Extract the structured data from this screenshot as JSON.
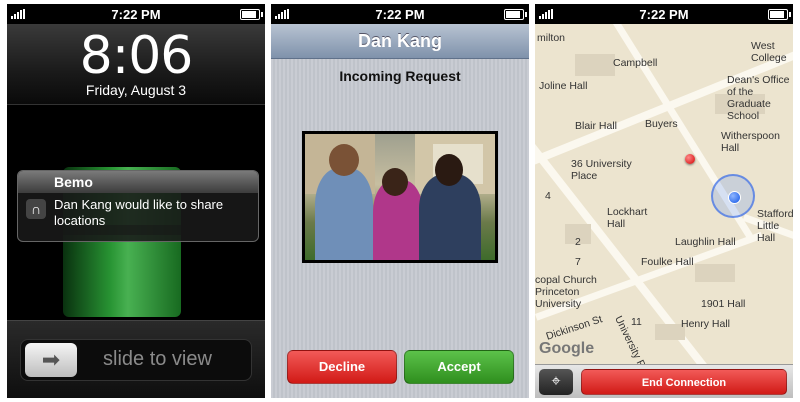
{
  "status": {
    "time": "7:22 PM"
  },
  "lock": {
    "clock": "8:06",
    "date": "Friday, August 3",
    "notification_app": "Bemo",
    "notification_text": "Dan Kang would like to share locations",
    "slider_text": "slide to view"
  },
  "request": {
    "nav_title": "Dan Kang",
    "title": "Incoming Request",
    "decline_label": "Decline",
    "accept_label": "Accept"
  },
  "map": {
    "labels": {
      "hamilton": "milton",
      "campbell": "Campbell",
      "west_college": "West College",
      "joline": "Joline Hall",
      "deans": "Dean's Office of the Graduate School",
      "buyers": "Buyers",
      "witherspoon": "Witherspoon Hall",
      "blair": "Blair Hall",
      "univ_place": "36 University Place",
      "lockhart": "Lockhart Hall",
      "laughlin": "Laughlin Hall",
      "stafford": "Stafford Little Hall",
      "foulke": "Foulke Hall",
      "church": "copal Church Princeton University",
      "hall1901": "1901 Hall",
      "henry": "Henry Hall",
      "dickinson": "Dickinson St",
      "univ_pl": "University Pl",
      "google": "Google",
      "n2": "2",
      "n4": "4",
      "n7": "7",
      "n11": "11"
    },
    "end_label": "End Connection"
  },
  "colors": {
    "decline": "#d11a16",
    "accept": "#2f8f1e",
    "location_dot": "#1256e6",
    "pin": "#d40000"
  }
}
